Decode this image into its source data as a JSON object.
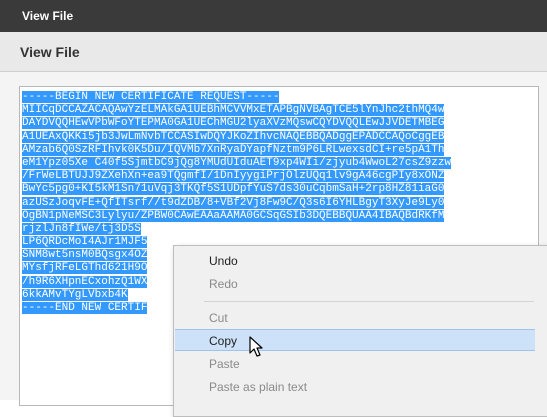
{
  "window": {
    "title": "View File"
  },
  "panel": {
    "title": "View File"
  },
  "certificate": {
    "lines": [
      "-----BEGIN NEW CERTIFICATE REQUEST-----",
      "MIICqDCCAZACAQAwYzELMAkGA1UEBhMCVVMxETAPBgNVBAgTCE5lYnJhc2thMQ4w",
      "DAYDVQQHEwVPbWFoYTEPMA0GA1UEChMGU2lyaXVzMQswCQYDVQQLEwJJVDETMBEG",
      "A1UEAxQKKi5jb3JwLmNvbTCCASIwDQYJKoZIhvcNAQEBBQADggEPADCCAQoCggEB",
      "AMzab6Q0SzRFIhvk0K5Du/IQVMb7XnRyaDYapfNztm9P6LRLwexsdCI+re5pA1Th",
      "eM1Ypz05Xe C40f5SjmtbC9jQg8YMUdUIduAET9xp4WIi/zjyub4WwoL27csZ9zzw",
      "/FrWeLBTUJJ9ZXehXn+ea9TQgmfI/1DnIyygiPrjOlzUQq1lv9gA46cgPIy8xONZ",
      "BwYc5pg0+KI5kM1Sn71uVqj3TKQf5S1UDpfYuS7ds30uCqbmSaH+2rp8HZ81iaG0",
      "azUSzJoqvFE+QfITsrf//t9dZDB/8+VBf2Vj8Fw9C/Q3s6I6YHLBgyT3XyJe9Ly0",
      "OgBN1pNeMSC3Lylyu/ZPBW0CAwEAAaAAMA0GCSqGSIb3DQEBBQUAA4IBAQBdRKfM",
      "rjzlJn8fIWe/tj3D5S",
      "LP6QRDcMoI4AJr1MJF5",
      "SNM8wt5nsM0BQsgx4OZ",
      "MYsfjRFeLGThd621H9O",
      "/h9R6XHpnECxohzQ1WX",
      "6kkAMvTYgLVbxb4K",
      "-----END NEW CERTIF"
    ]
  },
  "context_menu": {
    "items": [
      {
        "label": "Undo",
        "enabled": true
      },
      {
        "label": "Redo",
        "enabled": false
      },
      {
        "label": "Cut",
        "enabled": false
      },
      {
        "label": "Copy",
        "enabled": true,
        "highlighted": true
      },
      {
        "label": "Paste",
        "enabled": false
      },
      {
        "label": "Paste as plain text",
        "enabled": false
      }
    ]
  },
  "colors": {
    "selection": "#3399ff",
    "titlebar": "#3a3a3a",
    "menu_highlight": "#cde1f8"
  }
}
